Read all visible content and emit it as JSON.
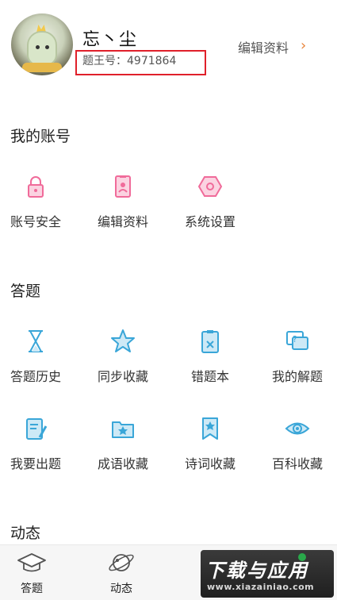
{
  "profile": {
    "username": "忘丶尘",
    "user_id": "题王号：4971864",
    "edit_link": "编辑资料",
    "edit_arrow": "›"
  },
  "account": {
    "title": "我的账号",
    "items": [
      {
        "label": "账号安全",
        "icon": "lock-icon"
      },
      {
        "label": "编辑资料",
        "icon": "id-card-icon"
      },
      {
        "label": "系统设置",
        "icon": "gear-hexagon-icon"
      }
    ]
  },
  "quiz": {
    "title": "答题",
    "items": [
      {
        "label": "答题历史",
        "icon": "hourglass-icon"
      },
      {
        "label": "同步收藏",
        "icon": "star-icon"
      },
      {
        "label": "错题本",
        "icon": "clipboard-x-icon"
      },
      {
        "label": "我的解题",
        "icon": "question-bubble-icon"
      },
      {
        "label": "我要出题",
        "icon": "pen-paper-icon"
      },
      {
        "label": "成语收藏",
        "icon": "folder-star-icon"
      },
      {
        "label": "诗词收藏",
        "icon": "bookmark-star-icon"
      },
      {
        "label": "百科收藏",
        "icon": "eye-icon"
      }
    ]
  },
  "activity": {
    "title": "动态"
  },
  "tabbar": {
    "tabs": [
      {
        "label": "答题",
        "icon": "graduation-cap-icon"
      },
      {
        "label": "动态",
        "icon": "planet-icon"
      }
    ]
  },
  "watermark": {
    "main": "下载与应用",
    "sub": "www.xiazainiao.com"
  },
  "colors": {
    "account_icon": "#f06b9a",
    "quiz_icon": "#3aa6d8",
    "edit_arrow": "#e8833a",
    "highlight_box": "#e0202a"
  }
}
